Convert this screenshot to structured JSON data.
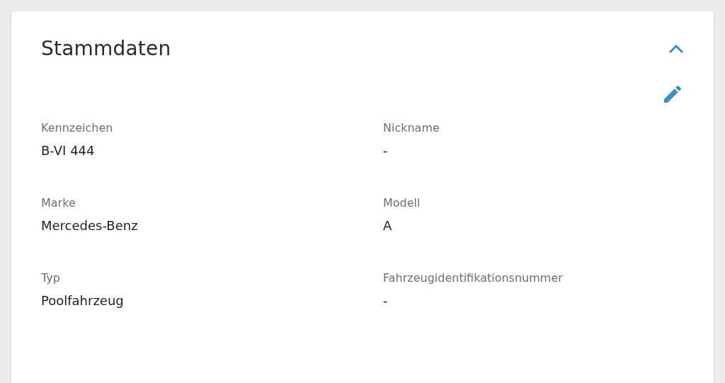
{
  "card": {
    "title": "Stammdaten",
    "expanded": true
  },
  "fields": [
    {
      "label": "Kennzeichen",
      "value": "B-VI 444"
    },
    {
      "label": "Nickname",
      "value": "-"
    },
    {
      "label": "Marke",
      "value": "Mercedes-Benz"
    },
    {
      "label": "Modell",
      "value": "A"
    },
    {
      "label": "Typ",
      "value": "Poolfahrzeug"
    },
    {
      "label": "Fahrzeugidentifikationsnummer",
      "value": "-"
    }
  ]
}
